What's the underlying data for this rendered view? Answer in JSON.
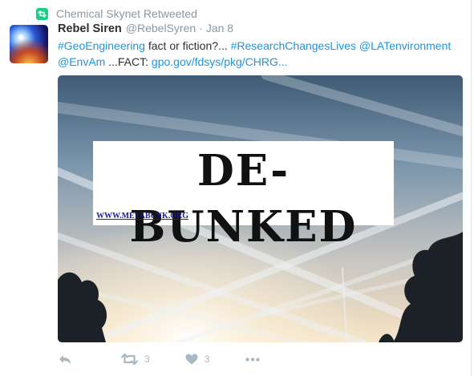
{
  "retweet_header": {
    "label": "Chemical Skynet Retweeted"
  },
  "tweet": {
    "fullname": "Rebel Siren",
    "handle": "@RebelSyren",
    "separator": "·",
    "time": "Jan 8",
    "text_parts": [
      {
        "text": "#GeoEngineering",
        "type": "hashtag"
      },
      {
        "text": " fact or fiction?... ",
        "type": "plain"
      },
      {
        "text": "#ResearchChangesLives",
        "type": "hashtag"
      },
      {
        "text": " ",
        "type": "plain"
      },
      {
        "text": "@LATenvironment",
        "type": "mention"
      },
      {
        "text": " ",
        "type": "plain"
      },
      {
        "text": "@EnvAm",
        "type": "mention"
      },
      {
        "text": " ...FACT: ",
        "type": "plain"
      },
      {
        "text": "gpo.gov/fdsys/pkg/CHRG...",
        "type": "url"
      }
    ],
    "media": {
      "stamp_text": "DE-BUNKED",
      "stamp_url": "WWW.METABUNK.ORG"
    }
  },
  "actions": {
    "reply_icon": "reply-icon",
    "retweet_icon": "retweet-icon",
    "retweet_count": "3",
    "like_icon": "heart-icon",
    "like_count": "3",
    "more_icon": "more-icon"
  },
  "colors": {
    "link": "#1b95e0",
    "retweet_green": "#19cf86",
    "muted": "#8899a6",
    "action_gray": "#aab8c2"
  }
}
